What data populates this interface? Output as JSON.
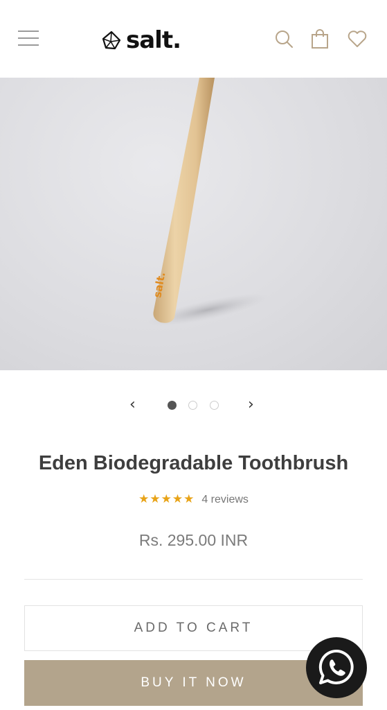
{
  "header": {
    "logo_text": "salt.",
    "icons": [
      "menu-icon",
      "search-icon",
      "shopping-bag-icon",
      "heart-icon"
    ]
  },
  "carousel": {
    "prev_label": "‹",
    "next_label": "›",
    "current_slide": 1,
    "total_slides": 3
  },
  "product": {
    "title": "Eden Biodegradable Toothbrush",
    "rating": 5,
    "reviews_label": "4 reviews",
    "price": "Rs. 295.00 INR",
    "brand_mark": "salt."
  },
  "actions": {
    "add_to_cart": "ADD TO CART",
    "buy_now": "BUY IT NOW"
  },
  "colors": {
    "star": "#e8a317",
    "buy_button": "#b3a48c",
    "header_icons": "#b8a58a"
  },
  "chat": {
    "icon": "whatsapp-icon"
  }
}
